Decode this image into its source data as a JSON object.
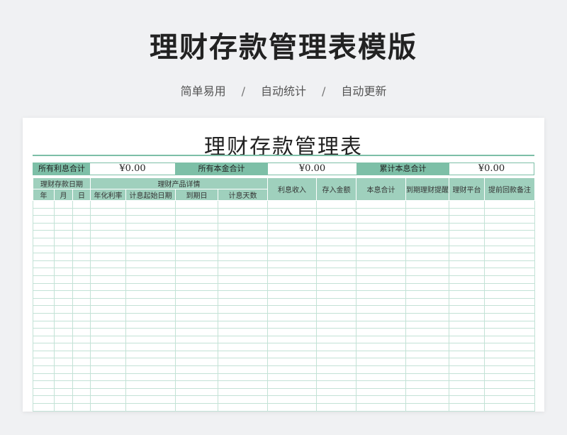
{
  "header": {
    "title": "理财存款管理表模版",
    "features": [
      "简单易用",
      "自动统计",
      "自动更新"
    ],
    "separator": "/"
  },
  "sheet": {
    "title": "理财存款管理表",
    "summary": [
      {
        "label": "所有利息合计",
        "value": "¥0.00"
      },
      {
        "label": "所有本金合计",
        "value": "¥0.00"
      },
      {
        "label": "累计本息合计",
        "value": "¥0.00"
      }
    ],
    "table": {
      "group_date": "理财存款日期",
      "group_product": "理财产品详情",
      "date_cols": [
        "年",
        "月",
        "日"
      ],
      "product_cols": [
        "年化利率",
        "计息起始日期",
        "到期日",
        "计息天数"
      ],
      "other_cols": [
        "利息收入",
        "存入金额",
        "本息合计",
        "到期理财提醒",
        "理财平台",
        "提前回款备注"
      ],
      "empty_rows": 28
    },
    "colors": {
      "accent": "#7dbfa7",
      "header_fill": "#9fd0bd",
      "grid_line": "#c3e2d6"
    }
  }
}
